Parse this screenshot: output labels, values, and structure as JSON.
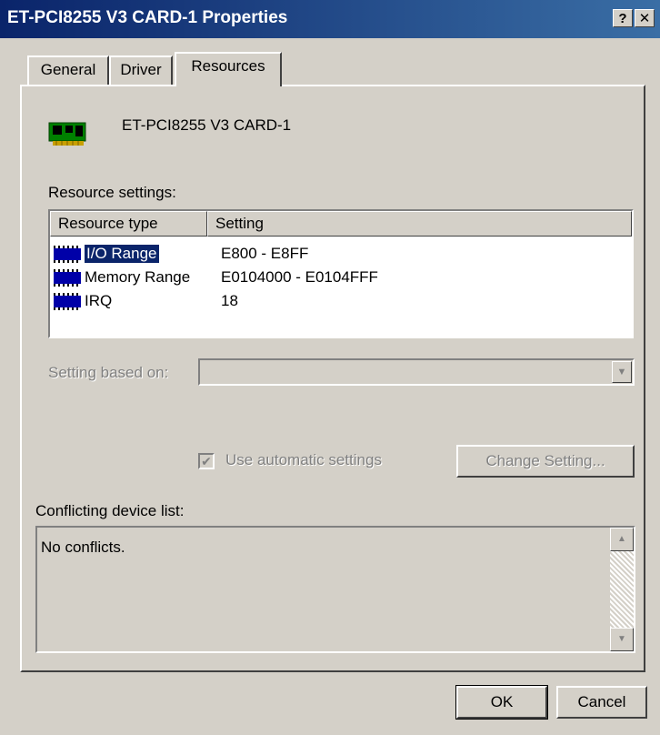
{
  "window": {
    "title": "ET-PCI8255 V3 CARD-1 Properties",
    "help_button": "?",
    "close_button": "✕"
  },
  "tabs": [
    {
      "label": "General"
    },
    {
      "label": "Driver"
    },
    {
      "label": "Resources"
    }
  ],
  "device": {
    "name": "ET-PCI8255 V3 CARD-1",
    "icon": "pci-card-icon"
  },
  "resources": {
    "section_label": "Resource settings:",
    "columns": [
      "Resource type",
      "Setting"
    ],
    "rows": [
      {
        "type": "I/O Range",
        "setting": "E800 - E8FF"
      },
      {
        "type": "Memory Range",
        "setting": "E0104000 - E0104FFF"
      },
      {
        "type": "IRQ",
        "setting": "18"
      }
    ]
  },
  "setting_based_on": {
    "label": "Setting based on:",
    "value": ""
  },
  "auto_settings": {
    "label": "Use automatic settings",
    "checked": true
  },
  "change_setting_label": "Change Setting...",
  "conflicts": {
    "label": "Conflicting device list:",
    "text": "No conflicts."
  },
  "buttons": {
    "ok": "OK",
    "cancel": "Cancel"
  },
  "colors": {
    "titlebar": "#0a246a",
    "face": "#d4d0c8",
    "selection": "#0a246a"
  }
}
